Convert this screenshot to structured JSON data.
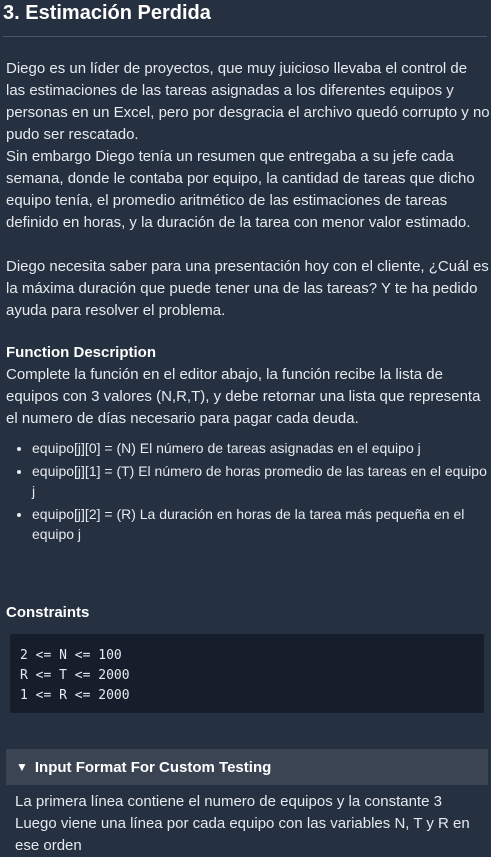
{
  "title": "3. Estimación Perdida",
  "description": {
    "p1": "Diego es un líder de proyectos, que muy juicioso llevaba el control de las estimaciones de las tareas asignadas a los diferentes equipos y personas en un Excel, pero por desgracia el archivo quedó corrupto y no pudo ser rescatado.",
    "p2": "Sin embargo Diego tenía un resumen que entregaba a su jefe cada semana, donde le contaba por equipo, la cantidad de tareas que dicho equipo tenía, el promedio aritmético de las estimaciones de tareas definido en horas, y la duración de la tarea con menor valor estimado.",
    "p3": "Diego necesita saber para una presentación hoy con el cliente, ¿Cuál es la máxima duración que puede tener una de las tareas? Y te ha pedido ayuda para resolver el problema."
  },
  "function_description": {
    "heading": "Function Description",
    "text": "Complete la función en el editor abajo, la función recibe la lista de equipos con 3 valores (N,R,T), y debe retornar una lista que representa el numero de días necesario para pagar cada deuda.",
    "bullets": [
      "equipo[j][0] = (N) El número de tareas asignadas en el equipo j",
      "equipo[j][1] = (T) El número de horas promedio de las tareas en el equipo j",
      "equipo[j][2] = (R)  La duración en horas de la tarea más pequeña en el equipo j"
    ]
  },
  "constraints": {
    "heading": "Constraints",
    "lines": [
      "2 <= N <= 100",
      "R <= T <= 2000",
      "1 <= R <= 2000"
    ]
  },
  "input_format": {
    "caret": "▼",
    "heading": "Input Format For Custom Testing",
    "line1": "La primera línea contiene el numero de equipos y la constante 3",
    "line2": "Luego viene una línea por cada equipo con las variables N, T y R en ese orden"
  }
}
